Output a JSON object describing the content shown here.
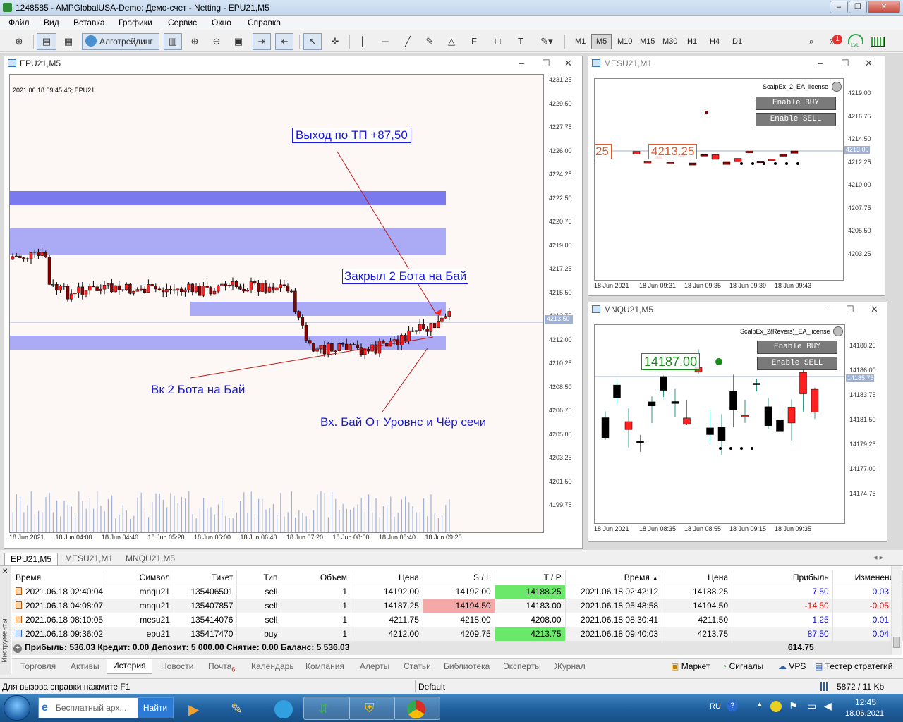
{
  "window": {
    "title": "1248585 - AMPGlobalUSA-Demo: Демо-счет - Netting - EPU21,M5"
  },
  "menu": [
    "Файл",
    "Вид",
    "Вставка",
    "Графики",
    "Сервис",
    "Окно",
    "Справка"
  ],
  "toolbar": {
    "algo_label": "Алготрейдинг",
    "timeframes": [
      "M1",
      "M5",
      "M10",
      "M15",
      "M30",
      "H1",
      "H4",
      "D1"
    ],
    "active_timeframe": "M5",
    "notify_count": "1",
    "lvl_label": "LVL"
  },
  "chart_main": {
    "title": "EPU21,M5",
    "info": "2021.06.18 09:45:46; EPU21",
    "current_price": "4213.50",
    "prices": [
      "4231.25",
      "4229.50",
      "4227.75",
      "4226.00",
      "4224.25",
      "4222.50",
      "4220.75",
      "4219.00",
      "4217.25",
      "4215.50",
      "4213.75",
      "4212.00",
      "4210.25",
      "4208.50",
      "4206.75",
      "4205.00",
      "4203.25",
      "4201.50",
      "4199.75"
    ],
    "times": [
      "18 Jun 2021",
      "18 Jun 04:00",
      "18 Jun 04:40",
      "18 Jun 05:20",
      "18 Jun 06:00",
      "18 Jun 06:40",
      "18 Jun 07:20",
      "18 Jun 08:00",
      "18 Jun 08:40",
      "18 Jun 09:20"
    ],
    "annotations": {
      "exit": "Выход по ТП  +87,50",
      "closed": "Закрыл  2 Бота на Бай",
      "entry": "Вк 2 Бота на Бай",
      "entry2": "Вх. Бай От Уровнс и Чёр сечи"
    },
    "colors": {
      "zone": "#aaaaf5",
      "zone_dark": "#7a7aee",
      "bg": "#fdf8f6"
    }
  },
  "chart_mesu": {
    "title": "MESU21,M1",
    "ea_label": "ScalpEx_2_EA_license",
    "buy_label": "Enable  BUY",
    "sell_label": "Enable  SELL",
    "price_box": "4213.25",
    "left_box": "25",
    "current_price": "4213.00",
    "prices": [
      "4219.00",
      "4216.75",
      "4214.50",
      "4212.25",
      "4210.00",
      "4207.75",
      "4205.50",
      "4203.25"
    ],
    "times": [
      "18 Jun 2021",
      "18 Jun 09:31",
      "18 Jun 09:35",
      "18 Jun 09:39",
      "18 Jun 09:43"
    ]
  },
  "chart_mnqu": {
    "title": "MNQU21,M5",
    "ea_label": "ScalpEx_2(Revers)_EA_license",
    "buy_label": "Enable  BUY",
    "sell_label": "Enable  SELL",
    "price_box": "14187.00",
    "current_price": "14185.75",
    "prices": [
      "14188.25",
      "14186.00",
      "14183.75",
      "14181.50",
      "14179.25",
      "14177.00",
      "14174.75"
    ],
    "times": [
      "18 Jun 2021",
      "18 Jun 08:35",
      "18 Jun 08:55",
      "18 Jun 09:15",
      "18 Jun 09:35"
    ]
  },
  "chart_tabs": [
    "EPU21,M5",
    "MESU21,M1",
    "MNQU21,M5"
  ],
  "history": {
    "columns": [
      "Время",
      "Символ",
      "Тикет",
      "Тип",
      "Объем",
      "Цена",
      "S / L",
      "T / P",
      "Время",
      "Цена",
      "Прибыль",
      "Изменение"
    ],
    "rows": [
      [
        "2021.06.18 02:40:04",
        "mnqu21",
        "135406501",
        "sell",
        "1",
        "14192.00",
        "14192.00",
        "14188.25",
        "2021.06.18 02:42:12",
        "14188.25",
        "7.50",
        "0.03 %"
      ],
      [
        "2021.06.18 04:08:07",
        "mnqu21",
        "135407857",
        "sell",
        "1",
        "14187.25",
        "14194.50",
        "14183.00",
        "2021.06.18 05:48:58",
        "14194.50",
        "-14.50",
        "-0.05 %"
      ],
      [
        "2021.06.18 08:10:05",
        "mesu21",
        "135414076",
        "sell",
        "1",
        "4211.75",
        "4218.00",
        "4208.00",
        "2021.06.18 08:30:41",
        "4211.50",
        "1.25",
        "0.01 %"
      ],
      [
        "2021.06.18 09:36:02",
        "epu21",
        "135417470",
        "buy",
        "1",
        "4212.00",
        "4209.75",
        "4213.75",
        "2021.06.18 09:40:03",
        "4213.75",
        "87.50",
        "0.04 %"
      ]
    ],
    "footer": "Прибыль: 536.03  Кредит: 0.00  Депозит: 5 000.00  Снятие: 0.00  Баланс: 5 536.03",
    "footer_total": "614.75",
    "side_label": "Инструменты"
  },
  "terminal_tabs": [
    "Торговля",
    "Активы",
    "История",
    "Новости",
    "Почта",
    "Календарь",
    "Компания",
    "Алерты",
    "Статьи",
    "Библиотека",
    "Эксперты",
    "Журнал"
  ],
  "mail_count": "6",
  "terminal_right": [
    "Маркет",
    "Сигналы",
    "VPS",
    "Тестер стратегий"
  ],
  "status": {
    "help": "Для вызова справки нажмите F1",
    "profile": "Default",
    "traffic": "5872 / 11 Kb"
  },
  "taskbar": {
    "search_placeholder": "Бесплатный арх...",
    "search_button": "Найти",
    "lang": "RU",
    "time": "12:45",
    "date": "18.06.2021"
  }
}
